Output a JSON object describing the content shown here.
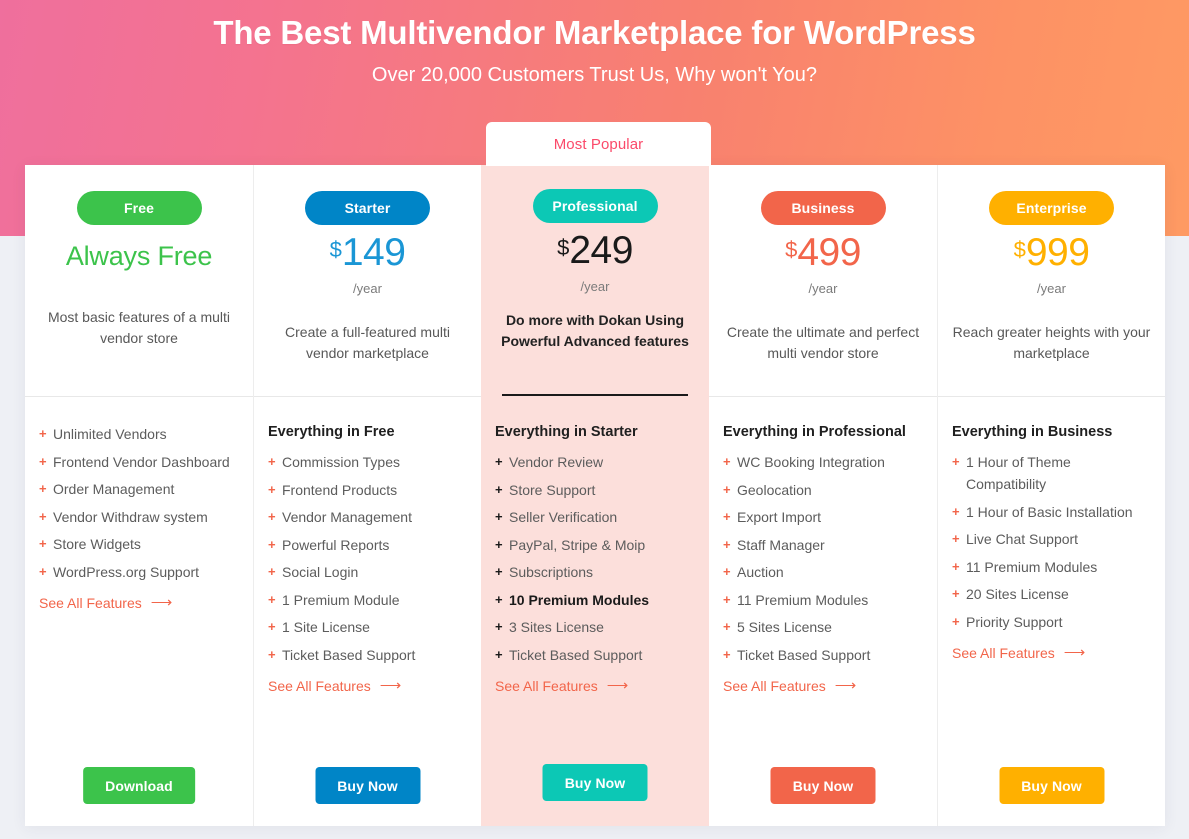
{
  "hero": {
    "title": "The Best Multivendor Marketplace for WordPress",
    "subtitle": "Over 20,000 Customers Trust Us, Why won't You?",
    "gradient_from": "#ef6f9d",
    "gradient_to": "#fe9a63"
  },
  "most_popular_label": "Most Popular",
  "see_all_label": "See All Features",
  "see_all_arrow": "⟶",
  "plus_icon": "+",
  "plans": [
    {
      "badge": "Free",
      "badge_color": "#3cc34b",
      "accent": "#3cc34b",
      "price_currency": "",
      "price_amount": "Always Free",
      "price_is_text": true,
      "period": "",
      "tagline": "Most basic features of a multi vendor store",
      "features_heading": "",
      "features": [
        {
          "text": "Unlimited Vendors",
          "bold": false
        },
        {
          "text": "Frontend Vendor Dashboard",
          "bold": false
        },
        {
          "text": "Order Management",
          "bold": false
        },
        {
          "text": "Vendor Withdraw system",
          "bold": false
        },
        {
          "text": "Store Widgets",
          "bold": false
        },
        {
          "text": "WordPress.org Support",
          "bold": false
        }
      ],
      "cta_label": "Download",
      "cta_color": "#3cc34b",
      "featured": false
    },
    {
      "badge": "Starter",
      "badge_color": "#0085c7",
      "accent": "#1a96d5",
      "price_currency": "$",
      "price_amount": "149",
      "price_is_text": false,
      "period": "/year",
      "tagline": "Create a full-featured multi vendor marketplace",
      "features_heading": "Everything in Free",
      "features": [
        {
          "text": "Commission Types",
          "bold": false
        },
        {
          "text": "Frontend Products",
          "bold": false
        },
        {
          "text": "Vendor Management",
          "bold": false
        },
        {
          "text": "Powerful Reports",
          "bold": false
        },
        {
          "text": "Social Login",
          "bold": false
        },
        {
          "text": "1 Premium Module",
          "bold": false
        },
        {
          "text": "1 Site License",
          "bold": false
        },
        {
          "text": "Ticket Based Support",
          "bold": false
        }
      ],
      "cta_label": "Buy Now",
      "cta_color": "#0085c7",
      "featured": false
    },
    {
      "badge": "Professional",
      "badge_color": "#0cc8b5",
      "accent": "#1a1a1a",
      "price_currency": "$",
      "price_amount": "249",
      "price_is_text": false,
      "period": "/year",
      "tagline": "Do more with Dokan Using Powerful Advanced features",
      "features_heading": "Everything in Starter",
      "features": [
        {
          "text": "Vendor Review",
          "bold": false
        },
        {
          "text": "Store Support",
          "bold": false
        },
        {
          "text": "Seller Verification",
          "bold": false
        },
        {
          "text": "PayPal, Stripe & Moip",
          "bold": false
        },
        {
          "text": "Subscriptions",
          "bold": false
        },
        {
          "text": "10 Premium Modules",
          "bold": true
        },
        {
          "text": "3 Sites License",
          "bold": false
        },
        {
          "text": "Ticket Based Support",
          "bold": false
        }
      ],
      "cta_label": "Buy Now",
      "cta_color": "#0cc8b5",
      "featured": true
    },
    {
      "badge": "Business",
      "badge_color": "#f2654a",
      "accent": "#f2654a",
      "price_currency": "$",
      "price_amount": "499",
      "price_is_text": false,
      "period": "/year",
      "tagline": "Create the ultimate and perfect multi vendor store",
      "features_heading": "Everything in Professional",
      "features": [
        {
          "text": "WC Booking Integration",
          "bold": false
        },
        {
          "text": "Geolocation",
          "bold": false
        },
        {
          "text": "Export Import",
          "bold": false
        },
        {
          "text": "Staff Manager",
          "bold": false
        },
        {
          "text": "Auction",
          "bold": false
        },
        {
          "text": "11 Premium Modules",
          "bold": false
        },
        {
          "text": "5 Sites License",
          "bold": false
        },
        {
          "text": "Ticket Based Support",
          "bold": false
        }
      ],
      "cta_label": "Buy Now",
      "cta_color": "#f2654a",
      "featured": false
    },
    {
      "badge": "Enterprise",
      "badge_color": "#ffb000",
      "accent": "#ffb000",
      "price_currency": "$",
      "price_amount": "999",
      "price_is_text": false,
      "period": "/year",
      "tagline": "Reach greater heights with your marketplace",
      "features_heading": "Everything in Business",
      "features": [
        {
          "text": "1 Hour of Theme Compatibility",
          "bold": false
        },
        {
          "text": "1 Hour of Basic Installation",
          "bold": false
        },
        {
          "text": "Live Chat Support",
          "bold": false
        },
        {
          "text": "11 Premium Modules",
          "bold": false
        },
        {
          "text": "20 Sites License",
          "bold": false
        },
        {
          "text": "Priority Support",
          "bold": false
        }
      ],
      "cta_label": "Buy Now",
      "cta_color": "#ffb000",
      "featured": false
    }
  ]
}
